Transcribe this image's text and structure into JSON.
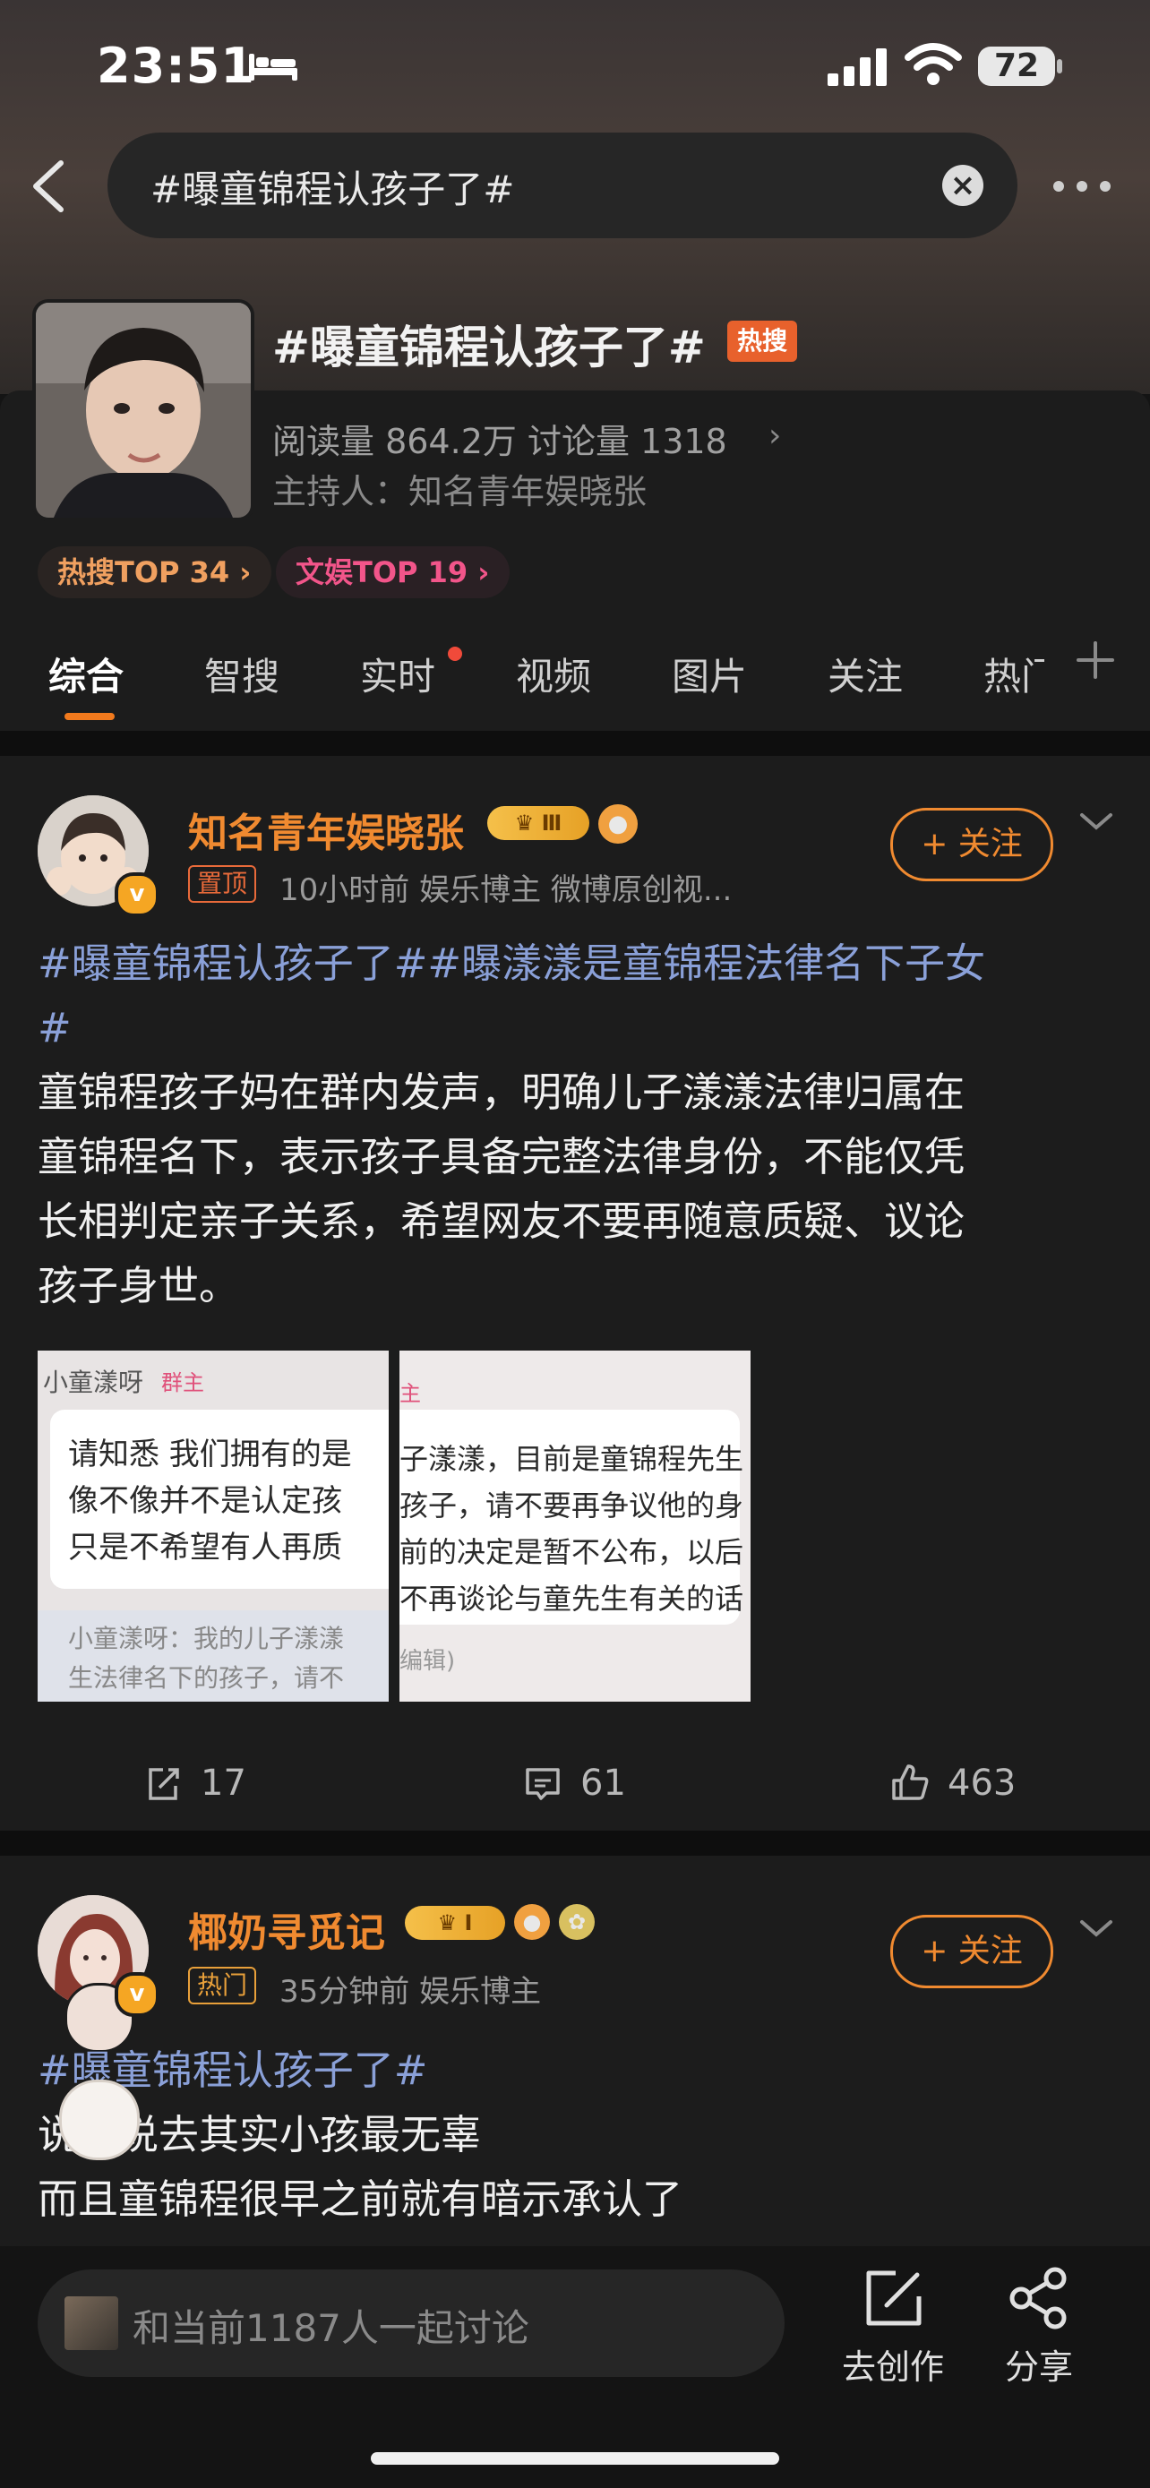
{
  "status": {
    "time": "23:51",
    "battery": "72"
  },
  "search": {
    "query": "#曝童锦程认孩子了#"
  },
  "topic": {
    "title": "#曝童锦程认孩子了#",
    "hot_tag": "热搜",
    "stats": "阅读量 864.2万   讨论量 1318",
    "host": "主持人：知名青年娱晓张",
    "rank1": "热搜TOP 34 ›",
    "rank2": "文娱TOP 19 ›"
  },
  "tabs": [
    "综合",
    "智搜",
    "实时",
    "视频",
    "图片",
    "关注",
    "热门"
  ],
  "post1": {
    "name": "知名青年娱晓张",
    "crown": "Ⅲ",
    "pin": "置顶",
    "meta": "10小时前  娱乐博主 微博原创视...",
    "follow": "+ 关注",
    "hashtag_line1": "#曝童锦程认孩子了##曝漾漾是童锦程法律名下子女",
    "hashtag_line2": "#",
    "body_lines": [
      "童锦程孩子妈在群内发声，明确儿子漾漾法律归属在",
      "童锦程名下，表示孩子具备完整法律身份，不能仅凭",
      "长相判定亲子关系，希望网友不要再随意质疑、议论",
      "孩子身世。"
    ],
    "pic1": {
      "sender": "小童漾呀",
      "role": "群主",
      "lines": [
        "请知悉 我们拥有的是",
        "像不像并不是认定孩",
        "只是不希望有人再质"
      ],
      "quote": [
        "小童漾呀：我的儿子漾漾",
        "生法律名下的孩子，请不"
      ]
    },
    "pic2": {
      "role": "主",
      "lines": [
        "子漾漾，目前是童锦程先生",
        "孩子，请不要再争议他的身",
        "前的决定是暂不公布，以后",
        "不再谈论与童先生有关的话"
      ],
      "footer": "编辑)"
    },
    "reposts": "17",
    "comments": "61",
    "likes": "463"
  },
  "post2": {
    "name": "椰奶寻觅记",
    "crown": "I",
    "tag": "热门",
    "meta": "35分钟前  娱乐博主",
    "follow": "+ 关注",
    "hashtag": "#曝童锦程认孩子了#",
    "body_lines": [
      "说来说去其实小孩最无辜",
      "而且童锦程很早之前就有暗示承认了"
    ]
  },
  "bottom": {
    "input_placeholder": "和当前1187人一起讨论",
    "create_label": "去创作",
    "share_label": "分享"
  },
  "colors": {
    "accent": "#f08a30",
    "hashtag": "#8aa0d8",
    "hot": "#e8612c"
  }
}
